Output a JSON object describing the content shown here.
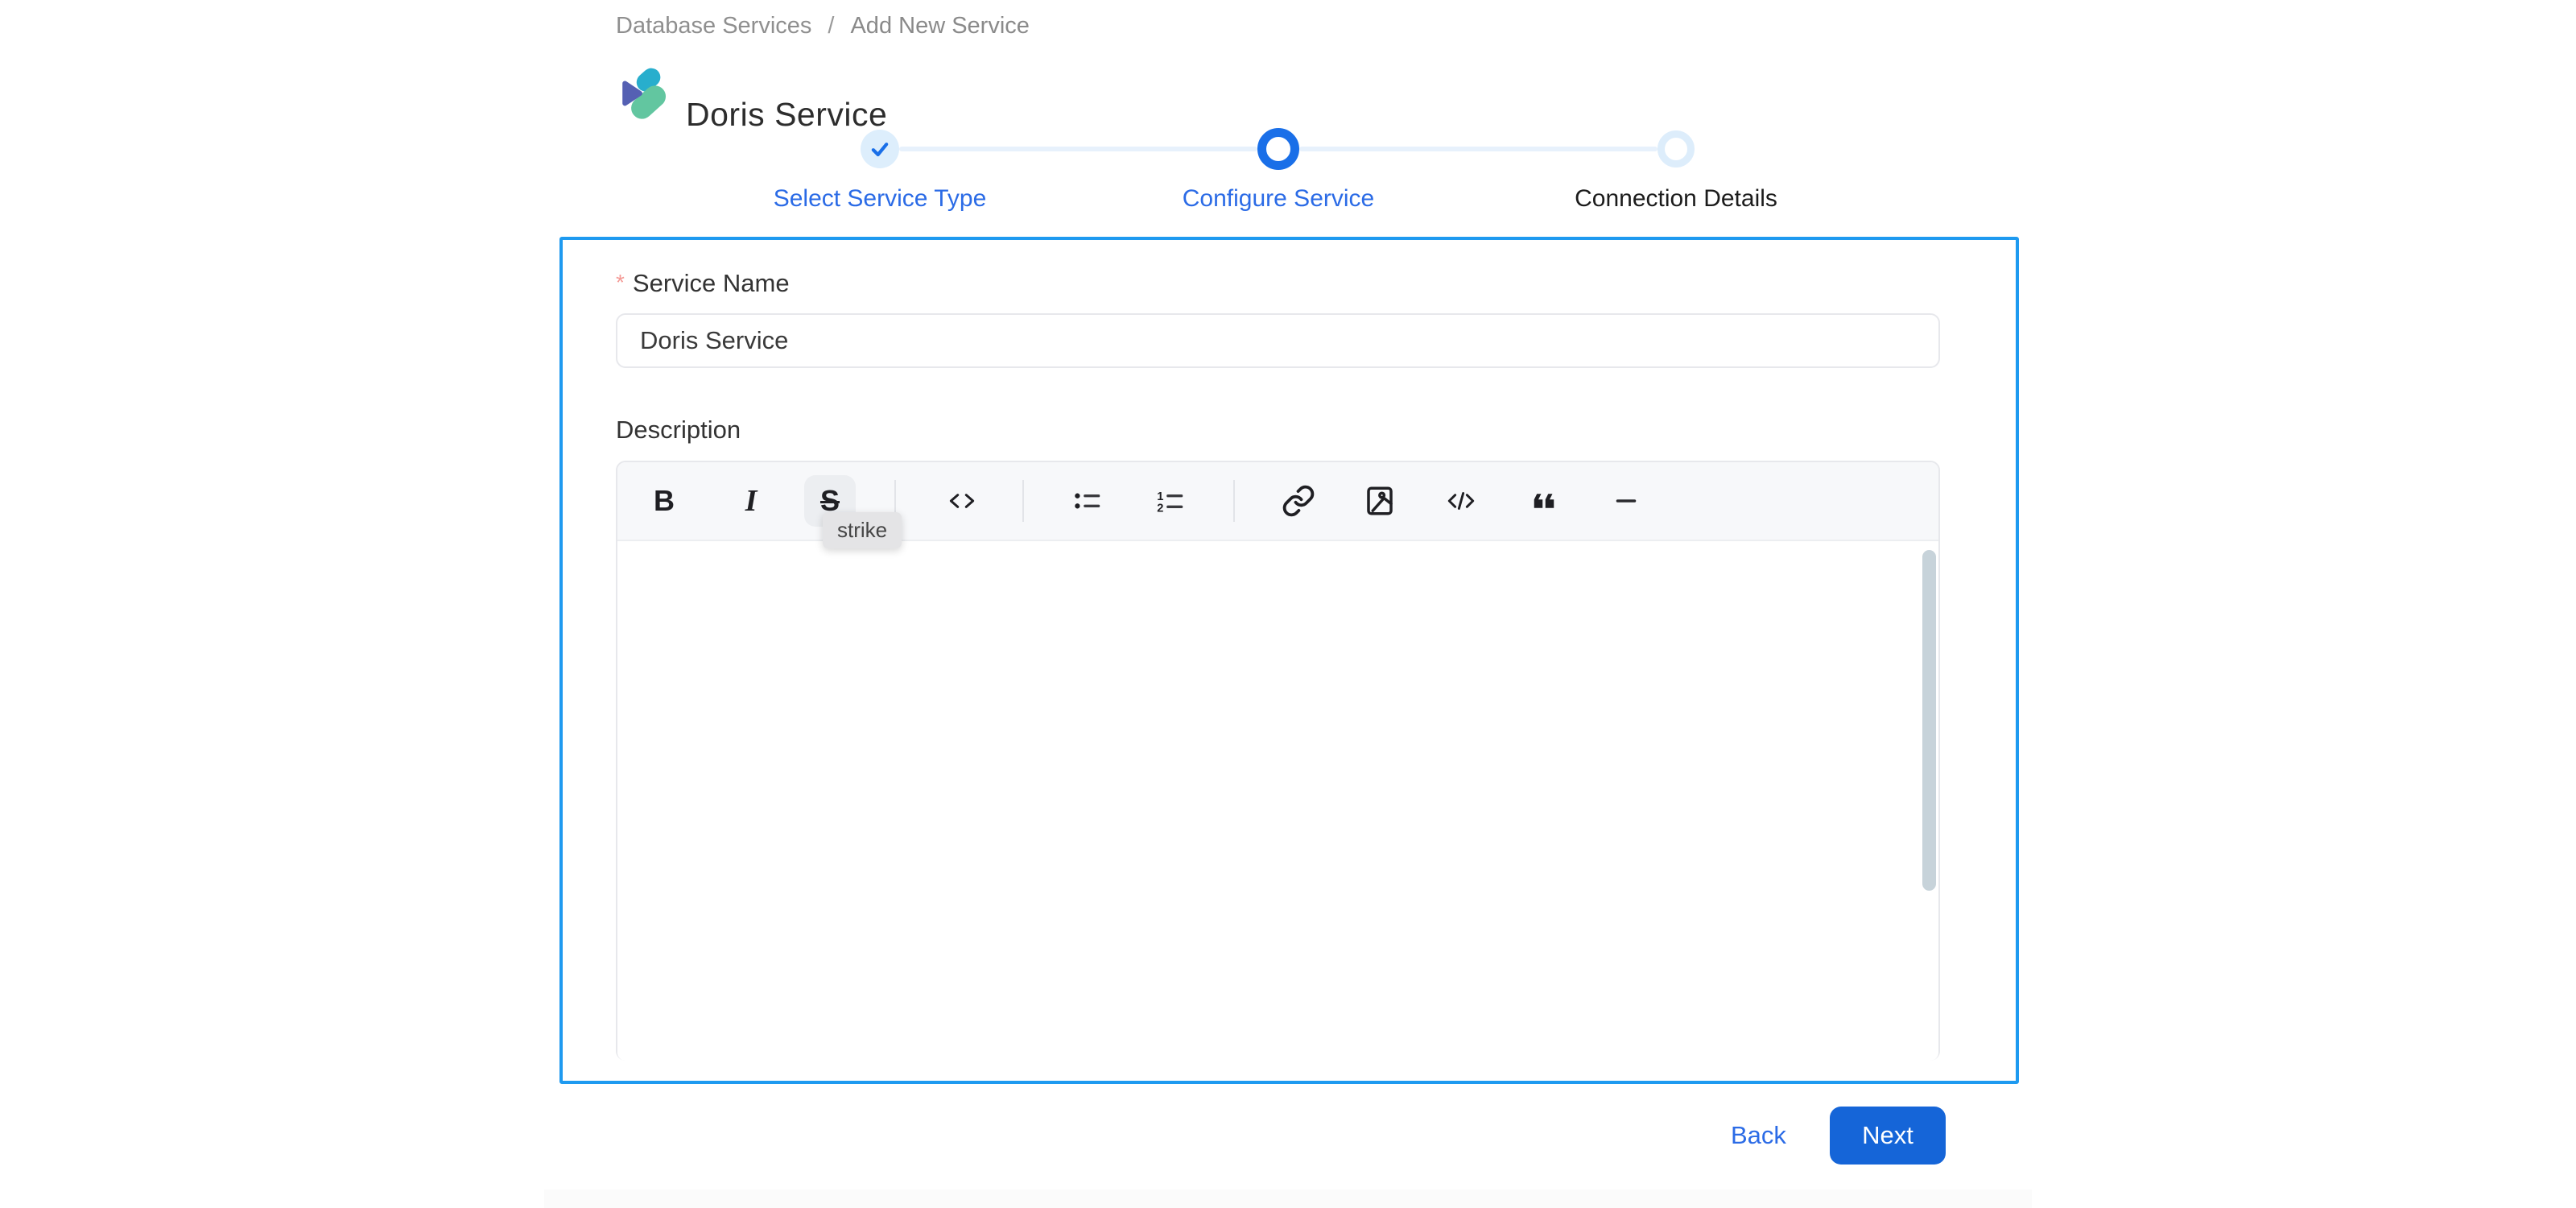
{
  "breadcrumb": {
    "items": [
      "Database Services",
      "Add New Service"
    ],
    "separator": "/"
  },
  "header": {
    "title": "Doris Service",
    "logo_icon": "doris-logo-icon"
  },
  "stepper": {
    "steps": [
      {
        "label": "Select Service Type",
        "state": "completed",
        "icon": "check-icon"
      },
      {
        "label": "Configure Service",
        "state": "active"
      },
      {
        "label": "Connection Details",
        "state": "pending"
      }
    ]
  },
  "form": {
    "service_name": {
      "label": "Service Name",
      "required_marker": "*",
      "value": "Doris Service"
    },
    "description": {
      "label": "Description",
      "content": ""
    },
    "editor": {
      "glyphs": {
        "bold": "B",
        "italic": "I",
        "strike": "S"
      },
      "toolbar_items": [
        "bold",
        "italic",
        "strike",
        "inline-code",
        "bullet-list",
        "ordered-list",
        "link",
        "image",
        "code-block",
        "blockquote",
        "horizontal-rule"
      ],
      "hovered_item": "strike",
      "tooltip": "strike"
    }
  },
  "actions": {
    "back_label": "Back",
    "next_label": "Next"
  },
  "colors": {
    "accent_blue": "#2b6be6",
    "active_step_blue": "#1a6fe8",
    "panel_border_blue": "#1e9af0",
    "next_button_blue": "#1565d8",
    "connector_light_blue": "#e7f1fc",
    "completed_step_bg": "#ddeefc",
    "pending_ring": "#ddedfb",
    "required_red": "#f49a96",
    "toolbar_bg": "#f7f8fa",
    "border_gray": "#e7e8ec",
    "scroll_thumb": "#c7d3da",
    "logo_cyan": "#28aecd",
    "logo_purple": "#5560b3",
    "logo_green": "#62c6a0"
  }
}
